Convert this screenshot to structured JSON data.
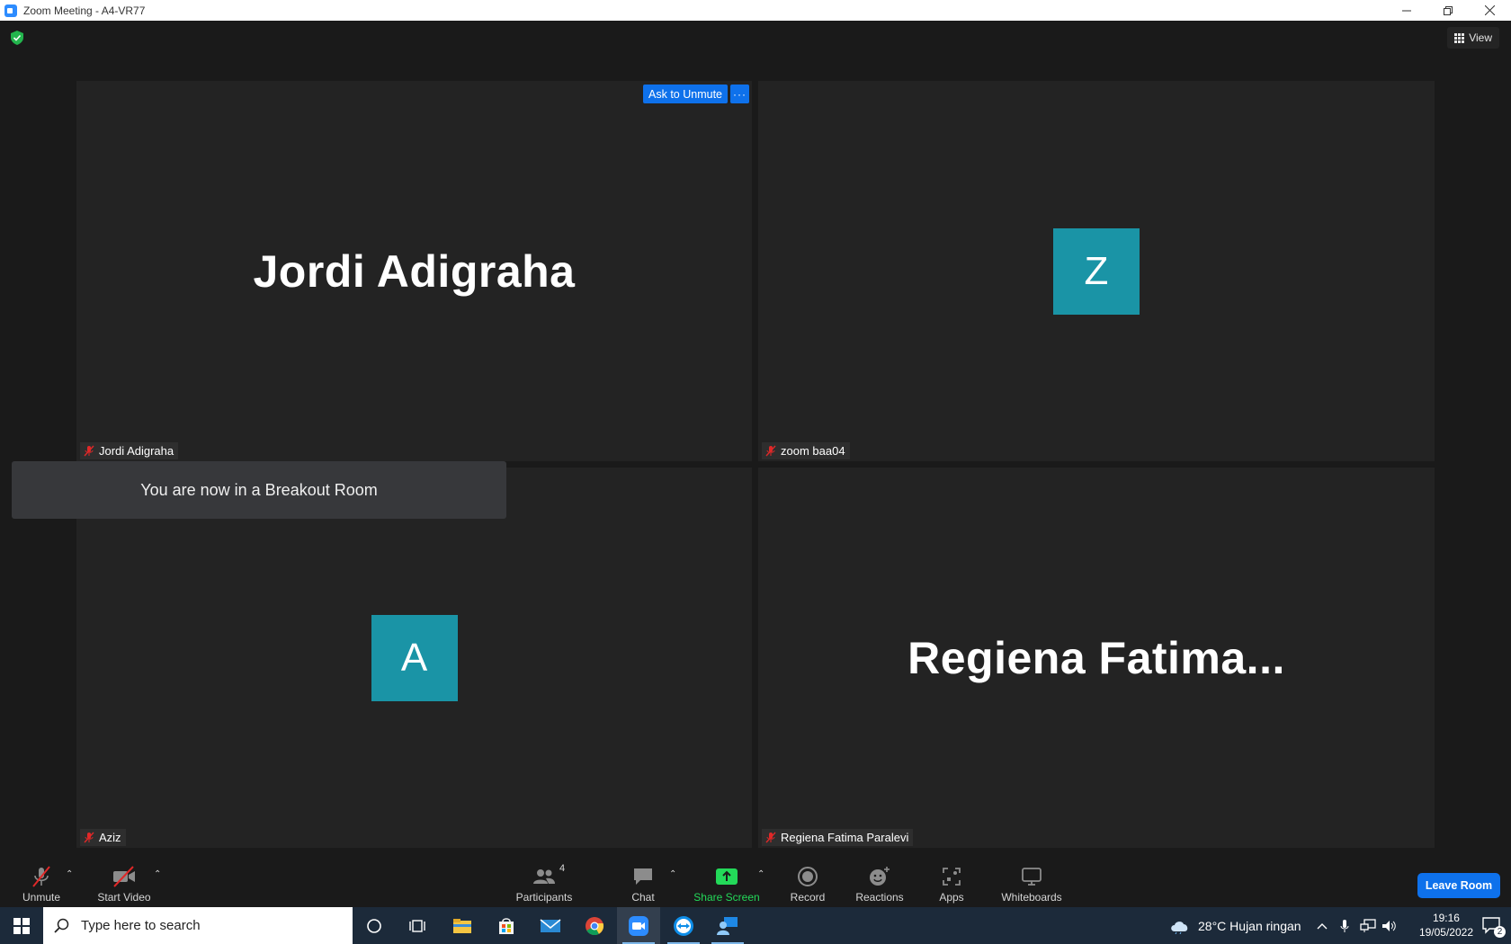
{
  "window": {
    "title": "Zoom Meeting - A4-VR77",
    "minimize_icon": "minimize-icon",
    "restore_icon": "restore-icon",
    "close_icon": "close-icon"
  },
  "header": {
    "view_label": "View"
  },
  "participants_tiles": [
    {
      "display": "Jordi Adigraha",
      "name": "Jordi Adigraha",
      "mode": "name",
      "muted": true
    },
    {
      "display": "Z",
      "name": "zoom baa04",
      "mode": "avatar",
      "muted": true,
      "avatar_color": "#1a94a6"
    },
    {
      "display": "A",
      "name": "Aziz",
      "mode": "avatar",
      "muted": true,
      "avatar_color": "#1a94a6"
    },
    {
      "display": "Regiena  Fatima...",
      "name": "Regiena Fatima Paralevi",
      "mode": "name",
      "muted": true
    }
  ],
  "tile_actions": {
    "ask_to_unmute": "Ask to Unmute",
    "more": "···"
  },
  "toast": {
    "message": "You are now in a Breakout Room"
  },
  "toolbar": {
    "unmute": "Unmute",
    "start_video": "Start Video",
    "participants": "Participants",
    "participants_count": "4",
    "chat": "Chat",
    "share_screen": "Share Screen",
    "record": "Record",
    "reactions": "Reactions",
    "apps": "Apps",
    "whiteboards": "Whiteboards",
    "leave_room": "Leave Room"
  },
  "taskbar": {
    "search_placeholder": "Type here to search",
    "weather": "28°C  Hujan ringan",
    "time": "19:16",
    "date": "19/05/2022",
    "notifications": "2"
  },
  "colors": {
    "accent_blue": "#0e71eb",
    "share_green": "#23d959",
    "avatar_teal": "#1a94a6",
    "muted_red": "#e02828"
  }
}
